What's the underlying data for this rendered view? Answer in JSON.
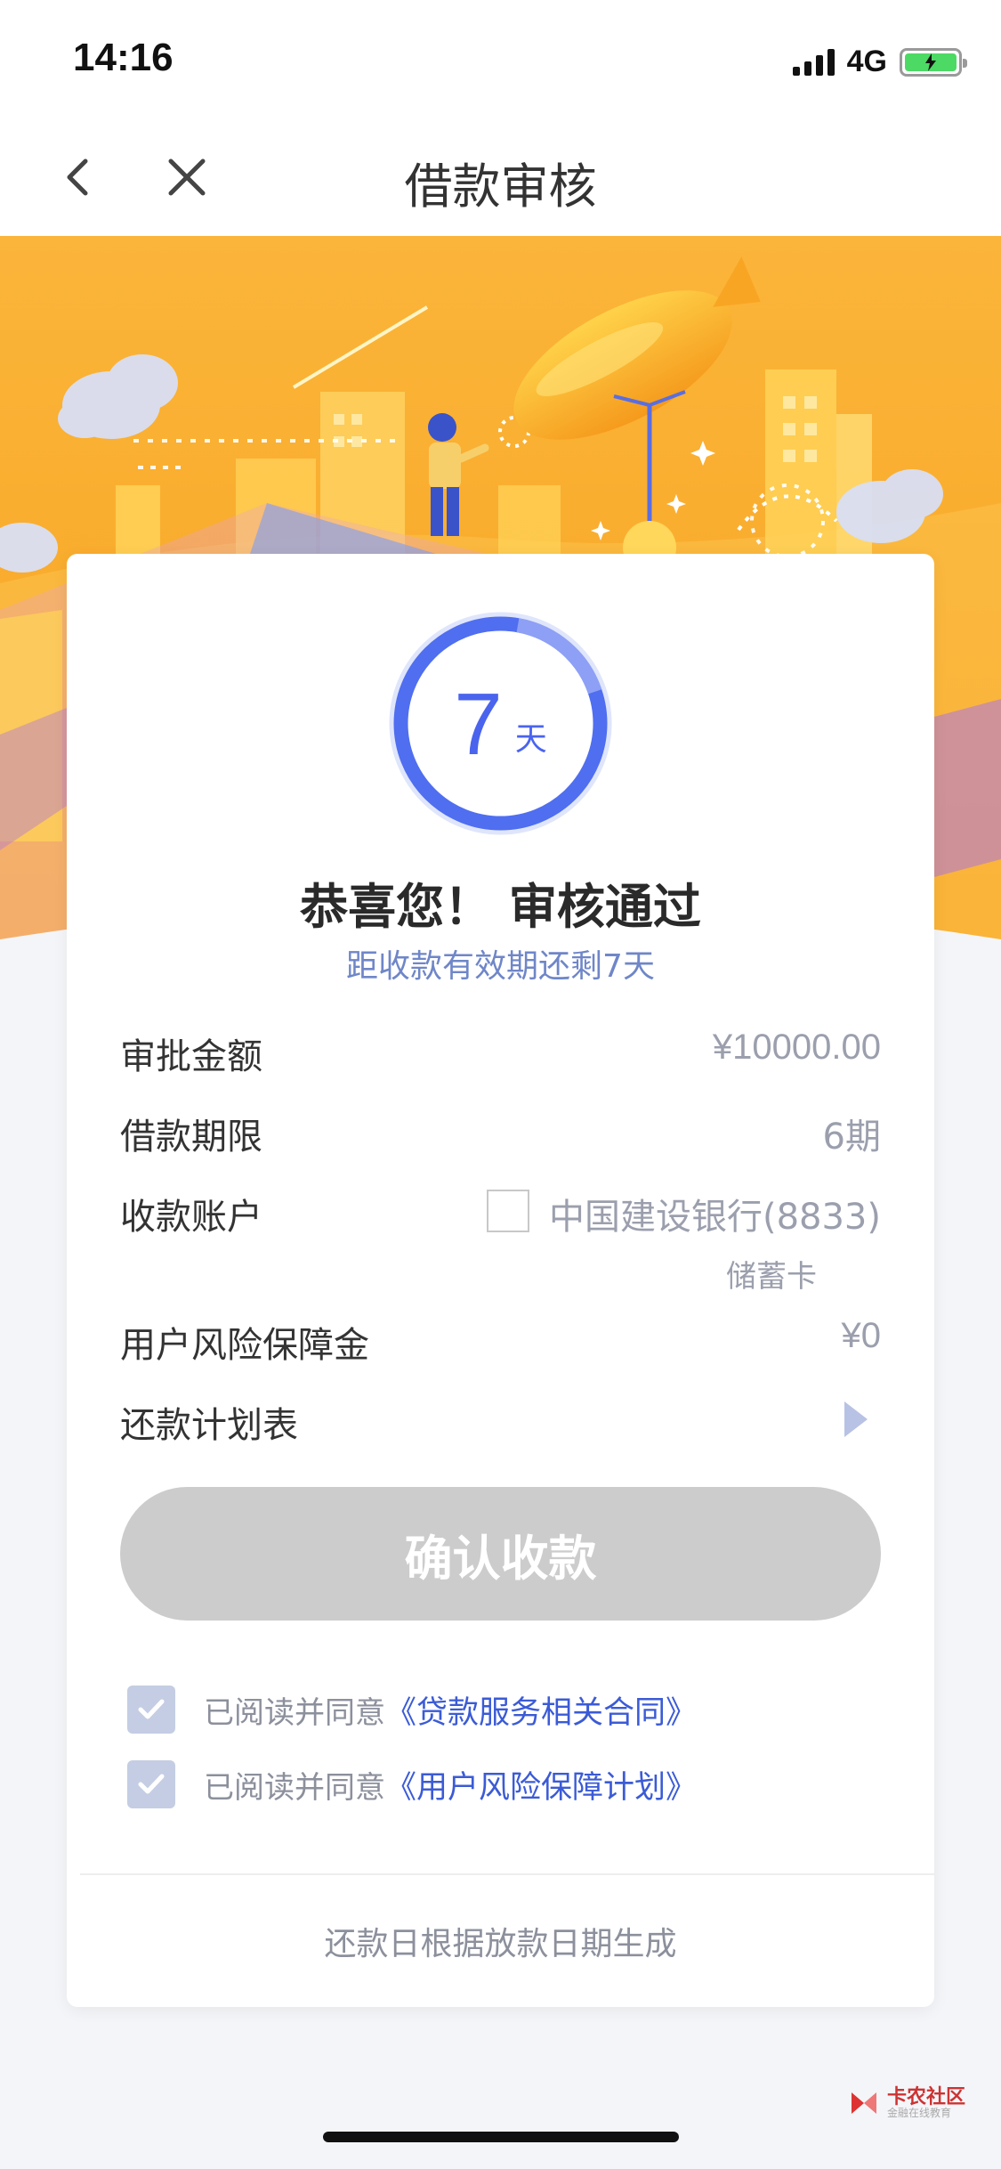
{
  "status_bar": {
    "time": "14:16",
    "network": "4G"
  },
  "nav": {
    "title": "借款审核",
    "back_icon": "chevron-left-icon",
    "close_icon": "close-icon"
  },
  "card": {
    "countdown": {
      "number": "7",
      "unit": "天"
    },
    "title": "恭喜您！ 审核通过",
    "subtitle": "距收款有效期还剩7天",
    "rows": {
      "amount": {
        "label": "审批金额",
        "value": "¥10000.00"
      },
      "term": {
        "label": "借款期限",
        "value": "6期"
      },
      "account": {
        "label": "收款账户",
        "value": "中国建设银行(8833)",
        "sub": "储蓄卡"
      },
      "guarantee": {
        "label": "用户风险保障金",
        "value": "¥0"
      },
      "schedule": {
        "label": "还款计划表"
      }
    },
    "confirm_button": "确认收款",
    "agreements": [
      {
        "prefix": "已阅读并同意",
        "link": "《贷款服务相关合同》",
        "checked": true
      },
      {
        "prefix": "已阅读并同意",
        "link": "《用户风险保障计划》",
        "checked": true
      }
    ],
    "footer": "还款日根据放款日期生成"
  },
  "watermark": {
    "title": "卡农社区",
    "subtitle": "金融在线教育"
  },
  "colors": {
    "accent": "#4a64ee",
    "link": "#3b5bd6",
    "banner": "#f9b432",
    "button_disabled": "#cccccc"
  }
}
